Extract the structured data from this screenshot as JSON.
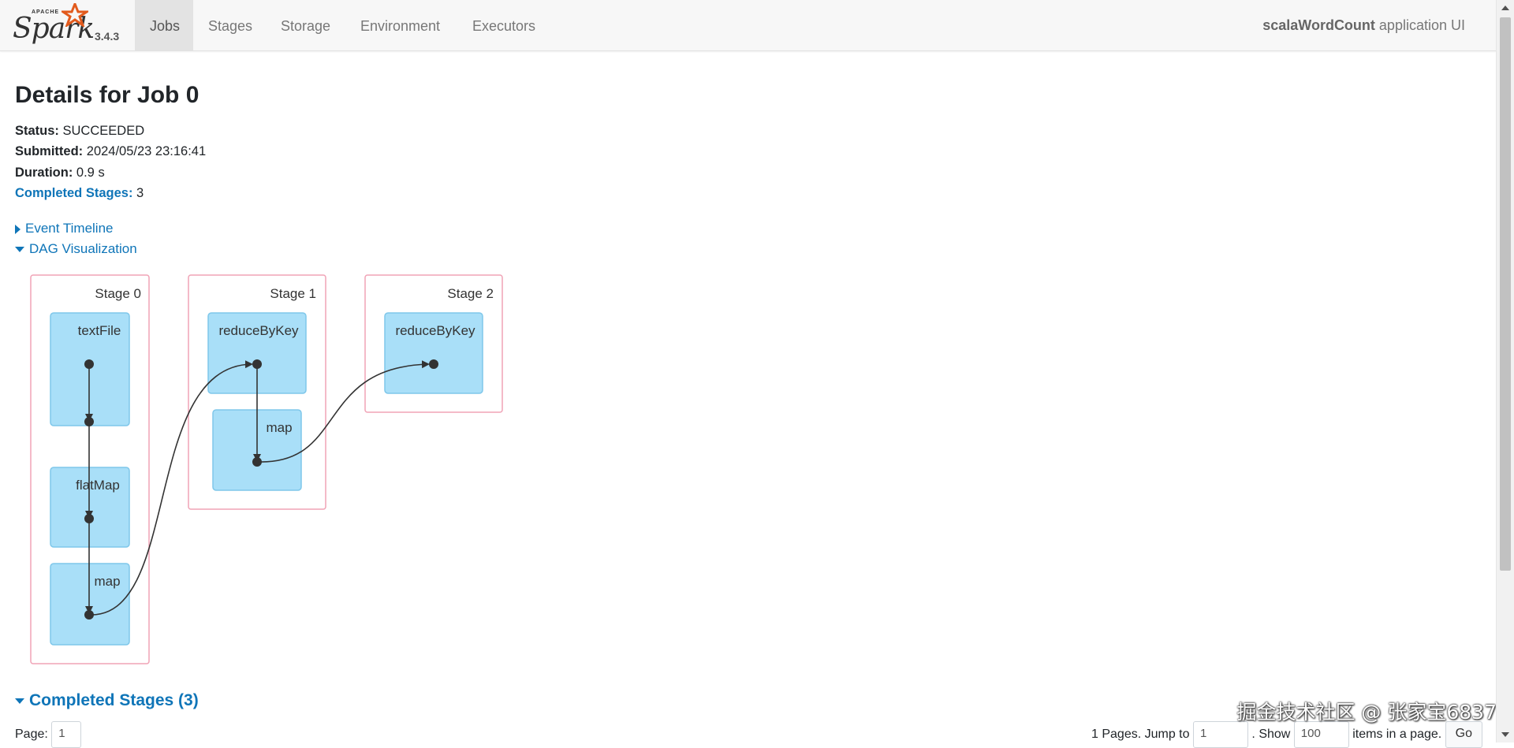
{
  "navbar": {
    "brand_apache": "APACHE",
    "brand_name": "Spark",
    "version": "3.4.3",
    "tabs": [
      {
        "label": "Jobs",
        "active": true
      },
      {
        "label": "Stages",
        "active": false
      },
      {
        "label": "Storage",
        "active": false
      },
      {
        "label": "Environment",
        "active": false
      },
      {
        "label": "Executors",
        "active": false
      }
    ],
    "app_name": "scalaWordCount",
    "app_suffix": " application UI"
  },
  "job": {
    "title": "Details for Job 0",
    "status_label": "Status:",
    "status_value": "SUCCEEDED",
    "submitted_label": "Submitted:",
    "submitted_value": "2024/05/23 23:16:41",
    "duration_label": "Duration:",
    "duration_value": "0.9 s",
    "completed_label": "Completed Stages:",
    "completed_value": "3"
  },
  "toggles": {
    "event_timeline": "Event Timeline",
    "dag_visualization": "DAG Visualization"
  },
  "dag": {
    "stages": [
      {
        "label": "Stage 0",
        "ops": [
          "textFile",
          "flatMap",
          "map"
        ]
      },
      {
        "label": "Stage 1",
        "ops": [
          "reduceByKey",
          "map"
        ]
      },
      {
        "label": "Stage 2",
        "ops": [
          "reduceByKey"
        ]
      }
    ]
  },
  "completed_stages": {
    "title": "Completed Stages (3)"
  },
  "pagination": {
    "page_label": "Page:",
    "page_value": "1",
    "pages_text": "1 Pages. Jump to",
    "jump_value": "1",
    "show_label": ". Show",
    "show_value": "100",
    "items_text": "items in a page.",
    "go_label": "Go"
  },
  "watermark": "掘金技术社区 @ 张家宝6837",
  "colors": {
    "link": "#0f75b8",
    "stage_border": "#f0a3b6",
    "op_fill": "#a9dff8",
    "op_border": "#7fc7ea"
  }
}
